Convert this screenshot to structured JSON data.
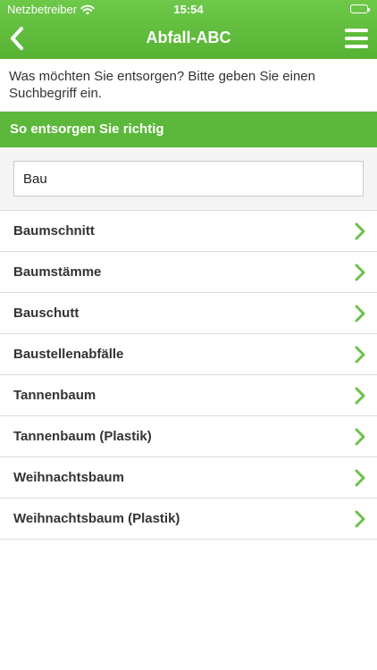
{
  "status_bar": {
    "carrier": "Netzbetreiber",
    "time": "15:54"
  },
  "nav": {
    "title": "Abfall-ABC"
  },
  "intro_text": "Was möchten Sie entsorgen? Bitte geben Sie einen Suchbegriff ein.",
  "section_header": "So entsorgen Sie richtig",
  "search": {
    "value": "Bau",
    "placeholder": ""
  },
  "results": [
    {
      "label": "Baumschnitt"
    },
    {
      "label": "Baumstämme"
    },
    {
      "label": "Bauschutt"
    },
    {
      "label": "Baustellenabfälle"
    },
    {
      "label": "Tannenbaum"
    },
    {
      "label": "Tannenbaum (Plastik)"
    },
    {
      "label": "Weihnachtsbaum"
    },
    {
      "label": "Weihnachtsbaum (Plastik)"
    }
  ],
  "colors": {
    "accent": "#5cb83a",
    "chevron": "#6cc04a"
  },
  "icons": {
    "back": "chevron-left-icon",
    "menu": "hamburger-menu-icon",
    "row": "chevron-right-icon",
    "wifi": "wifi-icon",
    "battery": "battery-icon"
  }
}
